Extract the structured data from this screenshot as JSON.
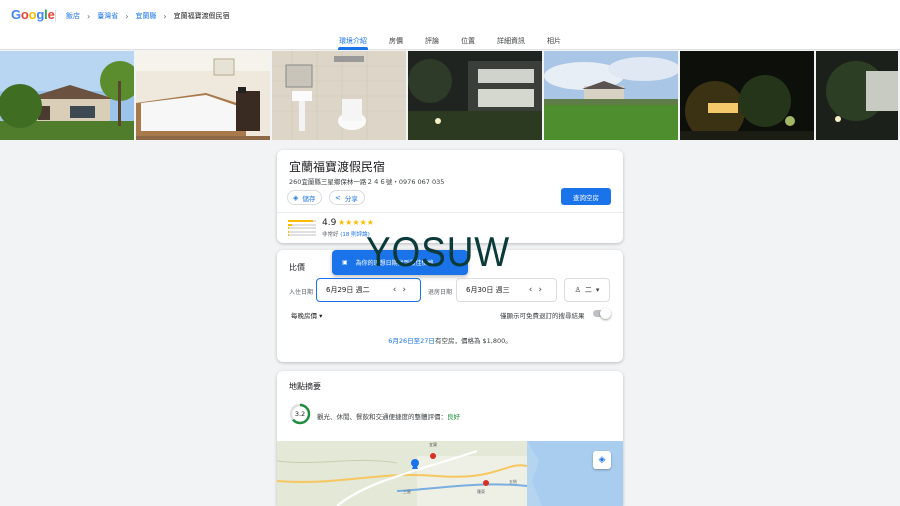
{
  "brand": {
    "logo_letters": [
      "G",
      "o",
      "o",
      "g",
      "l",
      "e"
    ]
  },
  "breadcrumb": {
    "items": [
      "飯店",
      "臺灣省",
      "宜蘭縣",
      "宜蘭福寶渡假民宿"
    ]
  },
  "tabs": [
    "環境介紹",
    "房價",
    "評論",
    "位置",
    "詳細資訊",
    "相片"
  ],
  "hotel": {
    "name": "宜蘭福寶渡假民宿",
    "address": "260宜蘭縣三星鄉保林一路２４６號・0976 067 035",
    "save_label": "儲存",
    "share_label": "分享",
    "check_label": "查詢空房",
    "rating": "4.9",
    "stars": "★★★★★",
    "rating_word": "非常好",
    "review_count": "(18 則評論)",
    "rating_distribution": [
      0.9,
      0.15,
      0.05,
      0.03,
      0.03
    ]
  },
  "prices": {
    "title": "比價",
    "banner": "為你的理想日期找到最佳價格",
    "checkin_label": "入住日期",
    "checkin_value": "6月29日 週二",
    "checkout_label": "退房日期",
    "checkout_value": "6月30日 週三",
    "guests_value": "二",
    "per_night_label": "每晚房價",
    "toggle_label": "僅顯示可免費退訂的搜尋結果",
    "availability_dates": "6月26日至27日",
    "availability_rest": "有空房，價格為 $1,800。"
  },
  "location": {
    "title": "地點摘要",
    "score": "3.2",
    "desc": "觀光、休閒、餐飲和交通便捷度的整體評價：",
    "desc_rating": "良好",
    "map_labels": [
      "宜蘭",
      "五結",
      "羅東",
      "三星"
    ]
  },
  "watermark": "YOSUW",
  "colors": {
    "accent": "#1a73e8",
    "star": "#fbbc04",
    "good": "#1e8e3e"
  }
}
